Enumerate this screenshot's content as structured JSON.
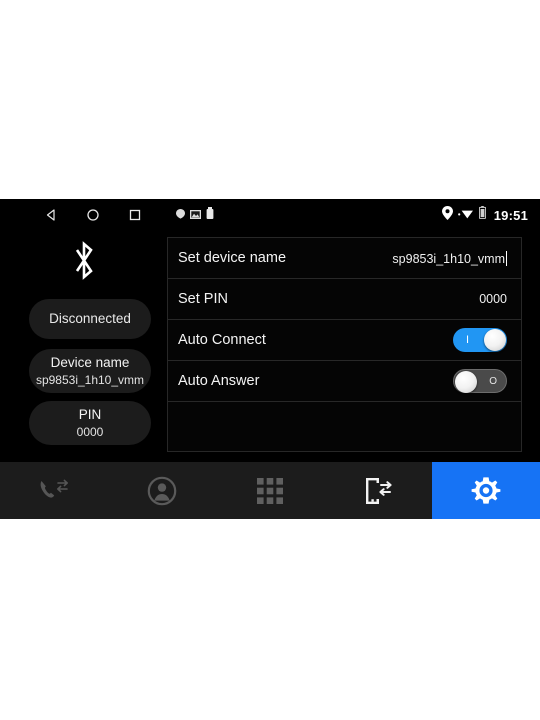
{
  "statusbar": {
    "nav": [
      {
        "name": "back-button",
        "icon": "triangle-left-icon"
      },
      {
        "name": "home-button",
        "icon": "circle-icon"
      },
      {
        "name": "recents-button",
        "icon": "square-icon"
      }
    ],
    "notifications": [
      {
        "name": "notification-dot-icon",
        "icon": "dot-icon"
      },
      {
        "name": "screenshot-icon",
        "icon": "image-icon"
      },
      {
        "name": "usb-icon",
        "icon": "usb-icon"
      }
    ],
    "status_icons": [
      {
        "name": "location-icon",
        "icon": "location-pin-icon"
      },
      {
        "name": "wifi-icon",
        "icon": "wifi-icon"
      },
      {
        "name": "battery-icon",
        "icon": "battery-icon"
      }
    ],
    "time": "19:51"
  },
  "left_panel": {
    "bluetooth_icon": "bluetooth-icon",
    "connection_status": "Disconnected",
    "device_name_title": "Device name",
    "device_name_value": "sp9853i_1h10_vmm",
    "pin_title": "PIN",
    "pin_value": "0000"
  },
  "settings": {
    "rows": [
      {
        "label": "Set device name",
        "value": "sp9853i_1h10_vmm",
        "type": "text",
        "editing": true
      },
      {
        "label": "Set PIN",
        "value": "0000",
        "type": "text",
        "editing": false
      },
      {
        "label": "Auto Connect",
        "value": "on",
        "type": "toggle",
        "mark": "I"
      },
      {
        "label": "Auto Answer",
        "value": "off",
        "type": "toggle",
        "mark": "O"
      }
    ]
  },
  "tabbar": {
    "items": [
      {
        "name": "tab-call-log",
        "icon": "phone-calls-icon",
        "active": false
      },
      {
        "name": "tab-contacts",
        "icon": "contact-avatar-icon",
        "active": false
      },
      {
        "name": "tab-dialpad",
        "icon": "dialpad-grid-icon",
        "active": false
      },
      {
        "name": "tab-sync",
        "icon": "phone-transfer-icon",
        "active": false
      },
      {
        "name": "tab-settings",
        "icon": "gear-icon",
        "active": true
      }
    ]
  },
  "colors": {
    "accent": "#1673f5",
    "toggle_on": "#2196f3",
    "background": "#000000",
    "tabbar": "#1c1c1c",
    "pill": "#1c1c1c"
  }
}
